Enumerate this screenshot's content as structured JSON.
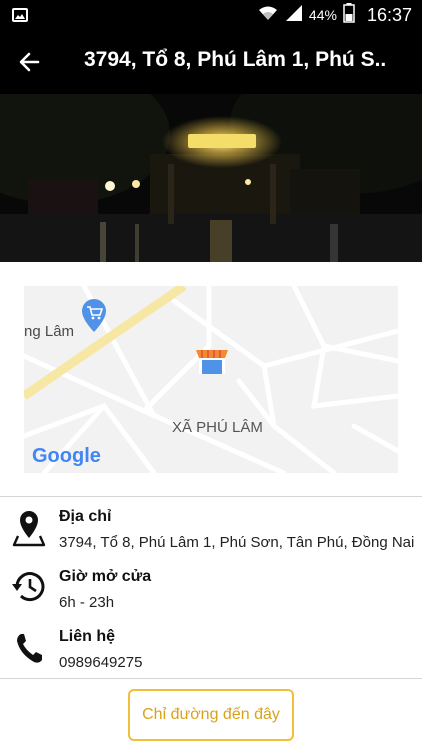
{
  "status_bar": {
    "battery": "44%",
    "time": "16:37",
    "icons": [
      "gallery-icon",
      "wifi-icon",
      "signal-icon",
      "battery-icon"
    ]
  },
  "app_bar": {
    "title": "3794, Tổ 8, Phú Lâm 1, Phú S..",
    "back_icon": "back-arrow-icon"
  },
  "map": {
    "label_road": "ng Lâm",
    "label_area": "XÃ PHÚ LÂM",
    "logo": "Google",
    "icons": [
      "shopping-cart-icon",
      "store-icon"
    ],
    "colors": {
      "background": "#f2f2f2",
      "road": "#ffffff",
      "main_road": "#f7e7a4"
    }
  },
  "info": {
    "address": {
      "label": "Địa chỉ",
      "value": "3794, Tổ 8, Phú Lâm 1, Phú Sơn, Tân Phú, Đồng Nai",
      "icon": "location-pin-icon"
    },
    "hours": {
      "label": "Giờ mở cửa",
      "value": "6h - 23h",
      "icon": "history-clock-icon"
    },
    "contact": {
      "label": "Liên hệ",
      "value": "0989649275",
      "icon": "phone-icon"
    }
  },
  "actions": {
    "directions_label": "Chỉ đường đến đây"
  },
  "colors": {
    "accent": "#f0be3a",
    "accent_text": "#d9a21c",
    "bar": "#000000"
  }
}
